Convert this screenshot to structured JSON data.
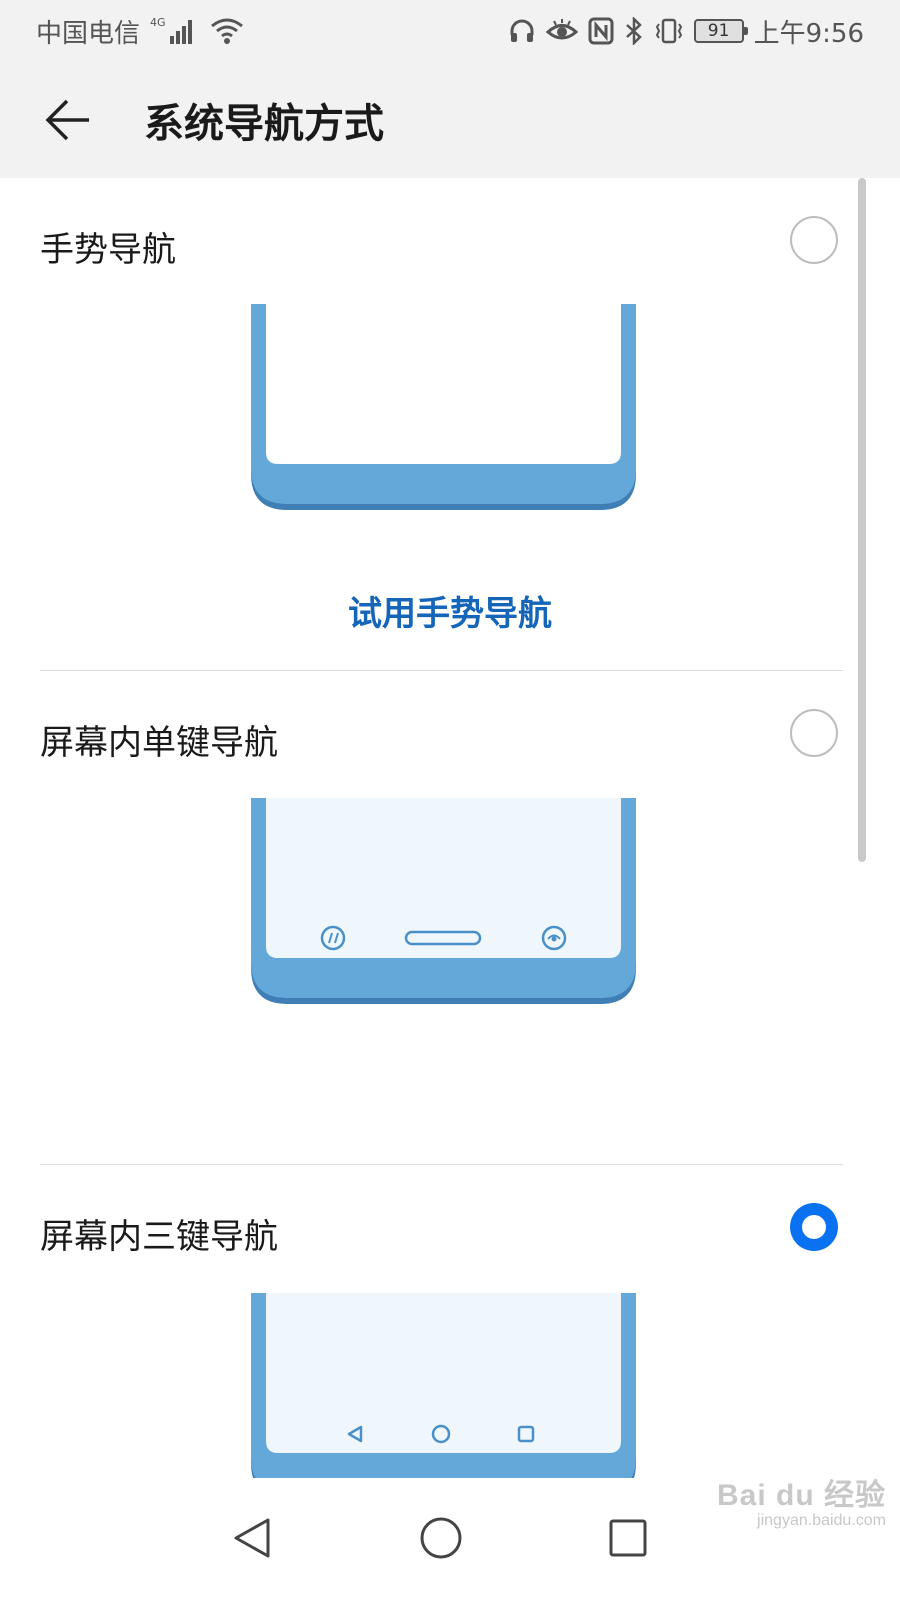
{
  "status_bar": {
    "carrier": "中国电信",
    "network": "4G",
    "time": "上午9:56",
    "battery": "91",
    "icons": [
      "signal-icon",
      "wifi-icon",
      "headphones-icon",
      "eye-icon",
      "nfc-icon",
      "bluetooth-icon",
      "vibrate-icon",
      "battery-icon"
    ]
  },
  "header": {
    "back_icon": "arrow-left-icon",
    "title": "系统导航方式"
  },
  "options": [
    {
      "title": "手势导航",
      "selected": false,
      "action_label": "试用手势导航"
    },
    {
      "title": "屏幕内单键导航",
      "selected": false
    },
    {
      "title": "屏幕内三键导航",
      "selected": true
    }
  ],
  "colors": {
    "accent": "#0a72f0",
    "link": "#1565b8",
    "phone_frame": "#64a8da",
    "phone_frame_dark": "#3f7fb5",
    "phone_screen": "#f0f7fc"
  },
  "nav_bar": {
    "icons": [
      "back-triangle-icon",
      "home-circle-icon",
      "recents-square-icon"
    ]
  },
  "watermark": {
    "logo": "Bai du 经验",
    "url": "jingyan.baidu.com"
  }
}
